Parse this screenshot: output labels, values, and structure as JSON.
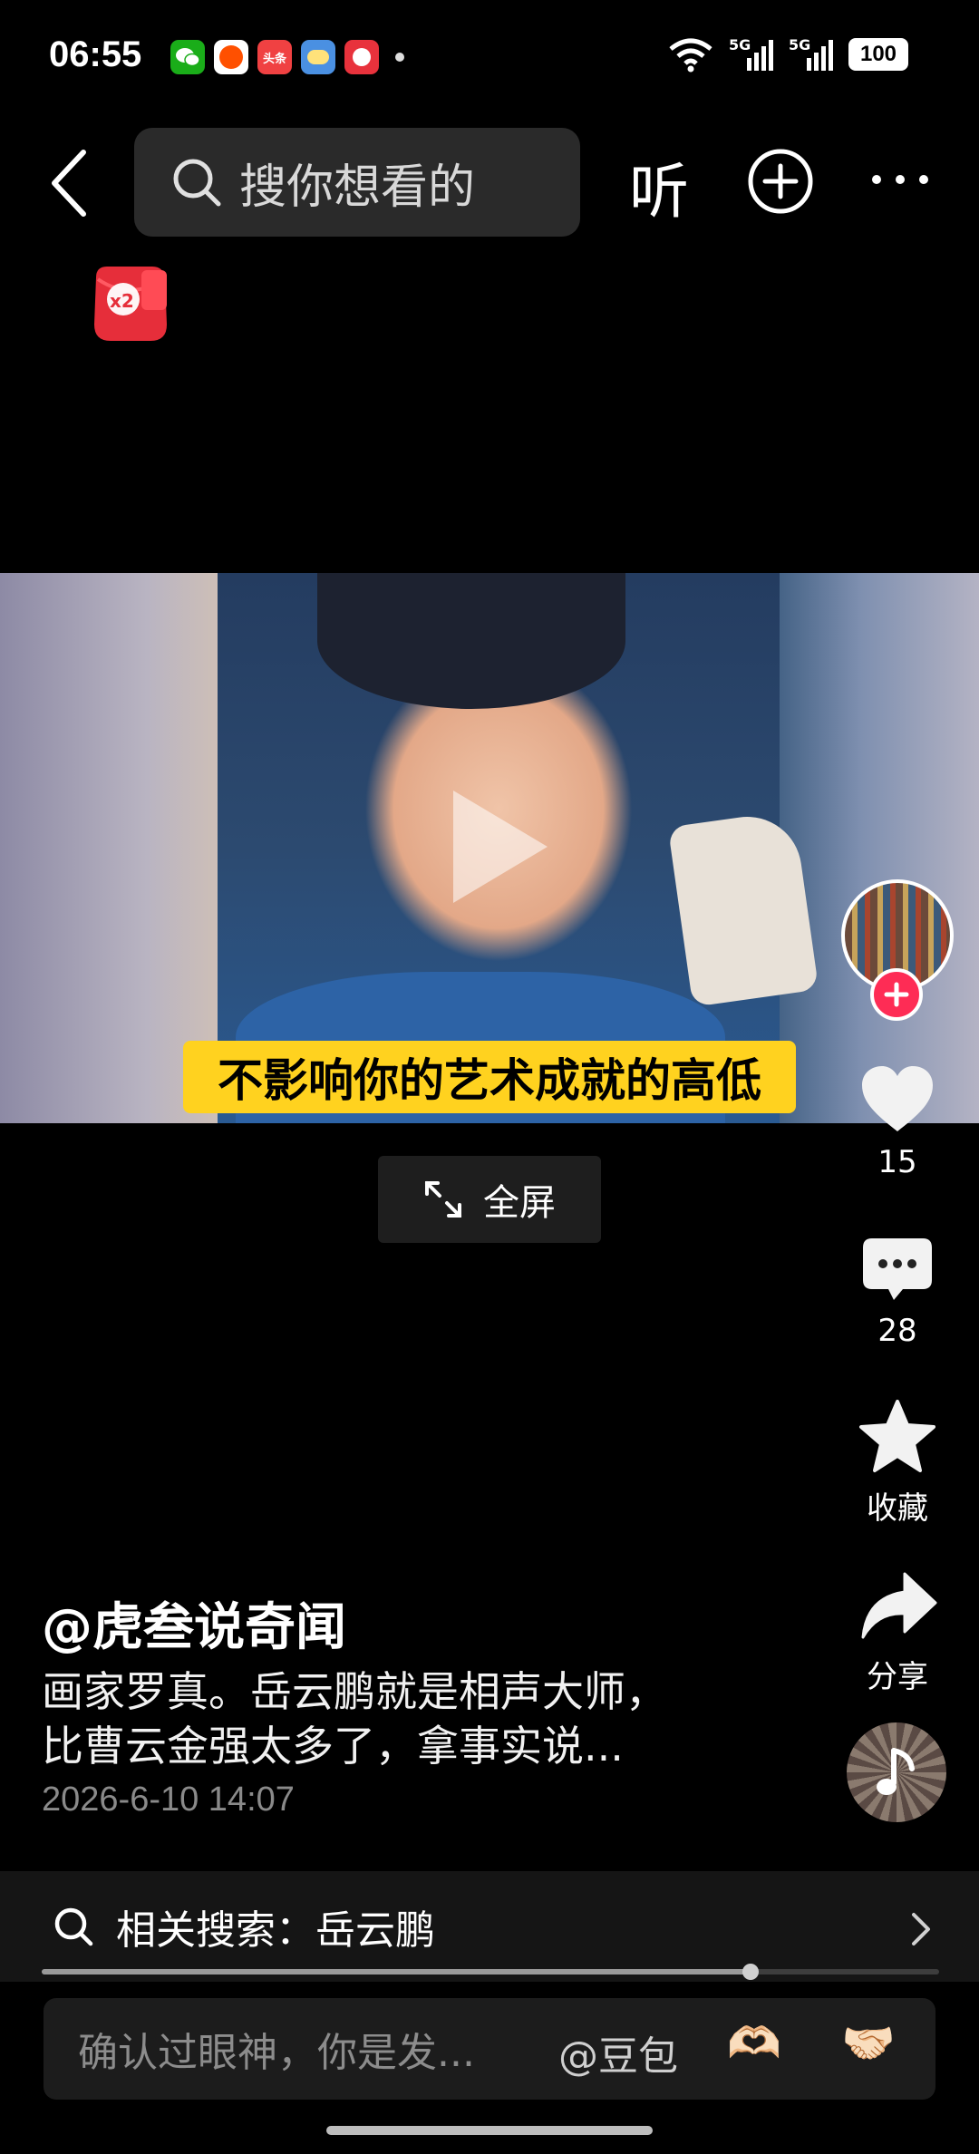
{
  "status_bar": {
    "time": "06:55",
    "notification_icons": [
      "wechat-icon",
      "taobao-icon",
      "toutiao-icon",
      "weather-icon",
      "game-icon"
    ],
    "toutiao_label": "头条",
    "network": [
      "wifi-icon",
      "5g-signal-icon",
      "5g-signal-icon"
    ],
    "net_label_1": "5G",
    "net_label_2": "5G",
    "battery": "100"
  },
  "header": {
    "search_placeholder": "搜你想看的",
    "listen_label": "听",
    "redpacket_badge": "x2"
  },
  "video": {
    "subtitle": "不影响你的艺术成就的高低",
    "fullscreen_label": "全屏",
    "progress": 0.79
  },
  "rail": {
    "like_count": "15",
    "comment_count": "28",
    "favorite_label": "收藏",
    "share_label": "分享"
  },
  "post": {
    "author": "@虎叁说奇闻",
    "description_line1": "画家罗真。岳云鹏就是相声大师，",
    "description_line2": "比曹云金强太多了，拿事实说...",
    "time": "2026-6-10 14:07"
  },
  "related_search": {
    "label": "相关搜索：岳云鹏"
  },
  "comment_bar": {
    "placeholder": "确认过眼神，你是发...",
    "mention": "@豆包",
    "emoji_1": "🫶🏻",
    "emoji_2": "🤝🏻"
  },
  "colors": {
    "accent": "#fe2c55",
    "subtitle_bg": "#ffd21f",
    "background": "#000000"
  }
}
